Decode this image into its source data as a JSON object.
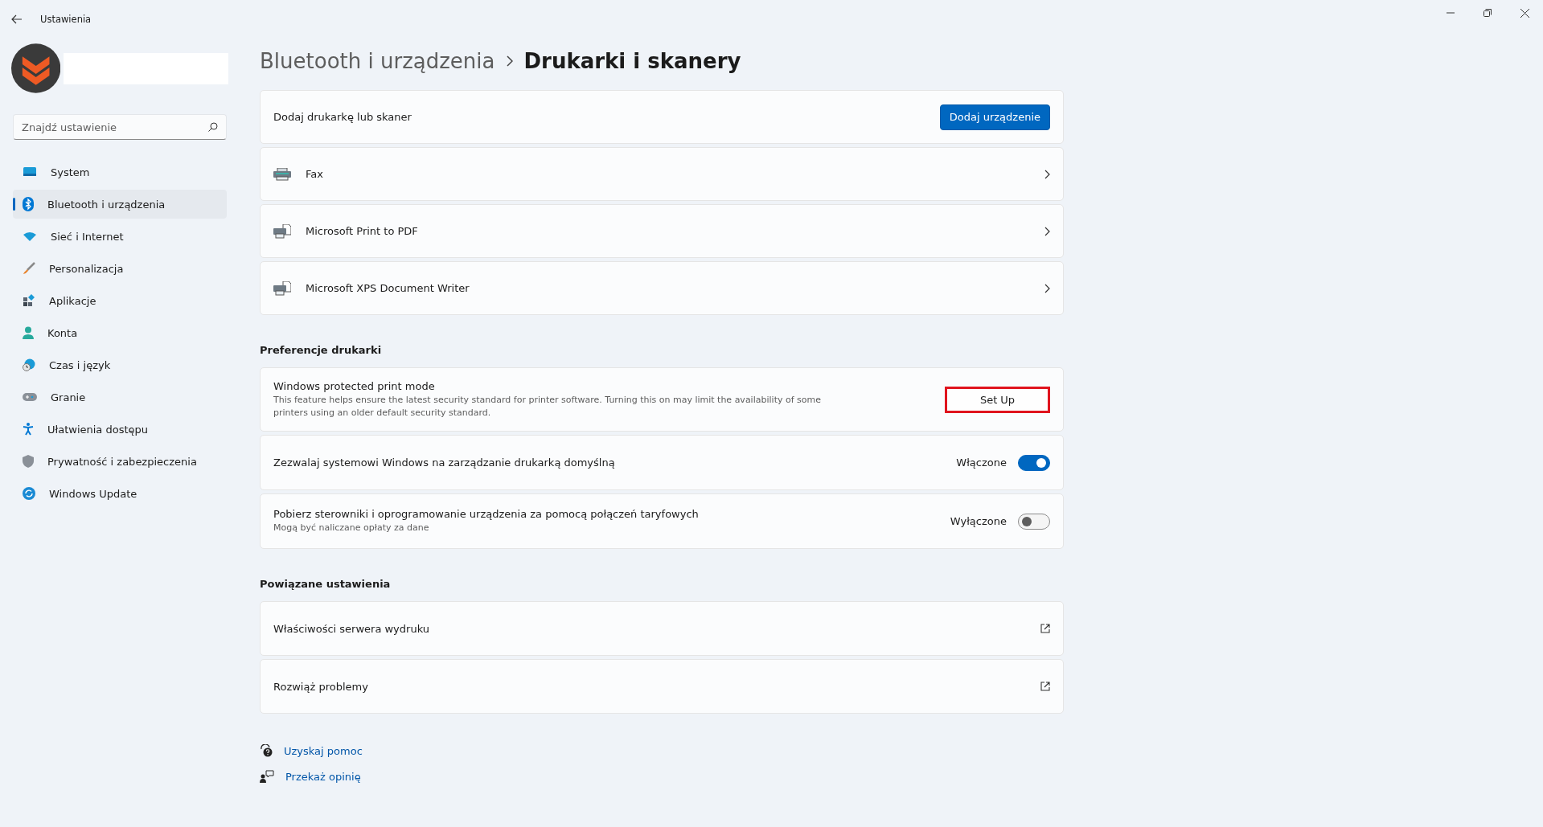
{
  "window": {
    "title": "Ustawienia"
  },
  "sidebar": {
    "search": {
      "placeholder": "Znajdź ustawienie"
    },
    "items": [
      {
        "label": "System",
        "kind": "system",
        "selected": false
      },
      {
        "label": "Bluetooth i urządzenia",
        "kind": "bluetooth",
        "selected": true
      },
      {
        "label": "Sieć i Internet",
        "kind": "wifi",
        "selected": false
      },
      {
        "label": "Personalizacja",
        "kind": "brush",
        "selected": false
      },
      {
        "label": "Aplikacje",
        "kind": "apps",
        "selected": false
      },
      {
        "label": "Konta",
        "kind": "person",
        "selected": false
      },
      {
        "label": "Czas i język",
        "kind": "clock",
        "selected": false
      },
      {
        "label": "Granie",
        "kind": "gamepad",
        "selected": false
      },
      {
        "label": "Ułatwienia dostępu",
        "kind": "accessibility",
        "selected": false
      },
      {
        "label": "Prywatność i zabezpieczenia",
        "kind": "shield",
        "selected": false
      },
      {
        "label": "Windows Update",
        "kind": "update",
        "selected": false
      }
    ]
  },
  "breadcrumb": [
    "Bluetooth i urządzenia",
    "Drukarki i skanery"
  ],
  "add_card": {
    "label": "Dodaj drukarkę lub skaner",
    "button": "Dodaj urządzenie"
  },
  "devices": [
    {
      "name": "Fax",
      "kind": "fax"
    },
    {
      "name": "Microsoft Print to PDF",
      "kind": "printer"
    },
    {
      "name": "Microsoft XPS Document Writer",
      "kind": "printer"
    }
  ],
  "preferences": {
    "title": "Preferencje drukarki",
    "rows": [
      {
        "kind": "button",
        "title": "Windows protected print mode",
        "description": "This feature helps ensure the latest security standard for printer software. Turning this on may limit the availability of some printers using an older default security standard.",
        "button": "Set Up",
        "highlighted": true
      },
      {
        "kind": "toggle",
        "title": "Zezwalaj systemowi Windows na zarządzanie drukarką domyślną",
        "state_label": "Włączone",
        "on": true
      },
      {
        "kind": "toggle",
        "title": "Pobierz sterowniki i oprogramowanie urządzenia za pomocą połączeń taryfowych",
        "description": "Mogą być naliczane opłaty za dane",
        "state_label": "Wyłączone",
        "on": false
      }
    ]
  },
  "related": {
    "title": "Powiązane ustawienia",
    "items": [
      "Właściwości serwera wydruku",
      "Rozwiąż problemy"
    ]
  },
  "links": [
    {
      "label": "Uzyskaj pomoc",
      "kind": "help"
    },
    {
      "label": "Przekaż opinię",
      "kind": "feedback"
    }
  ]
}
